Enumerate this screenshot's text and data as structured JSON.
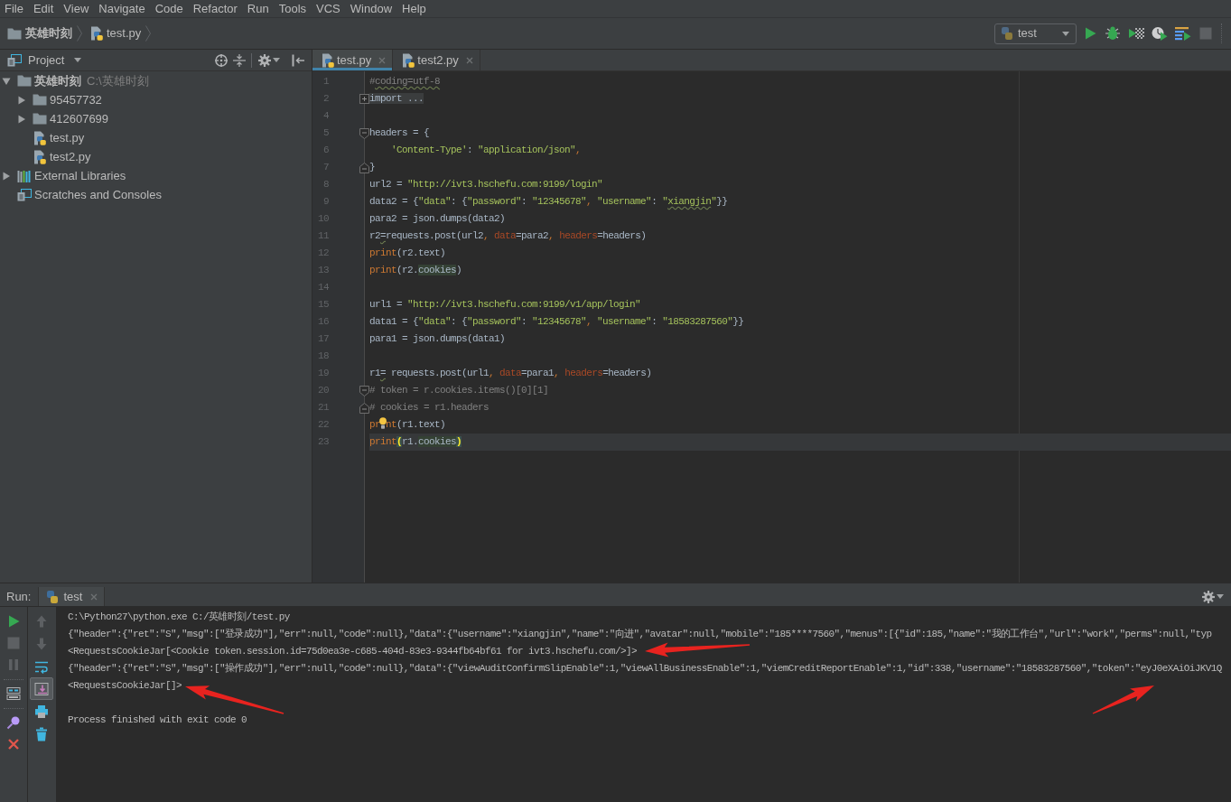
{
  "menu": [
    "File",
    "Edit",
    "View",
    "Navigate",
    "Code",
    "Refactor",
    "Run",
    "Tools",
    "VCS",
    "Window",
    "Help"
  ],
  "navigation_bar": {
    "breadcrumb": [
      {
        "label": "英雄时刻",
        "kind": "project-root"
      },
      {
        "label": "test.py",
        "kind": "python"
      }
    ],
    "run_config": "test",
    "toolbar": [
      {
        "kind": "run",
        "disabled": false
      },
      {
        "kind": "debug",
        "disabled": false
      },
      {
        "kind": "coverage",
        "disabled": false
      },
      {
        "kind": "profile",
        "disabled": false
      },
      {
        "kind": "concurrency",
        "disabled": false
      },
      {
        "kind": "stop",
        "disabled": true
      }
    ]
  },
  "project": {
    "title": "Project",
    "tools": [
      {
        "kind": "locate"
      },
      {
        "kind": "collapse"
      },
      {
        "kind": "separator"
      },
      {
        "kind": "settings"
      },
      {
        "kind": "hide"
      }
    ],
    "tree": [
      {
        "label": "英雄时刻",
        "path": "C:\\英雄时刻",
        "kind": "project-root",
        "expanded": true,
        "children": [
          {
            "label": "95457732",
            "kind": "folder",
            "expanded": false
          },
          {
            "label": "412607699",
            "kind": "folder",
            "expanded": false
          },
          {
            "label": "test.py",
            "kind": "python"
          },
          {
            "label": "test2.py",
            "kind": "python"
          }
        ]
      },
      {
        "label": "External Libraries",
        "kind": "library",
        "expanded": false
      },
      {
        "label": "Scratches and Consoles",
        "kind": "scratch"
      }
    ]
  },
  "editor": {
    "tabs": [
      {
        "label": "test.py",
        "selected": true
      },
      {
        "label": "test2.py",
        "selected": false
      }
    ],
    "lines": [
      {
        "number": "1",
        "current": false,
        "tokens": [
          {
            "text": "#",
            "kind": "comment"
          },
          {
            "text": "coding=utf-8",
            "kind": "comment",
            "decoration": {
              "kind": "wavy"
            }
          }
        ]
      },
      {
        "number": "2",
        "current": false,
        "fold": {
          "kind": "expand"
        },
        "tokens": [
          {
            "text": "import ...",
            "kind": "folded"
          }
        ]
      },
      {
        "number": "4",
        "current": false
      },
      {
        "number": "5",
        "current": false,
        "fold": {
          "kind": "start"
        },
        "tokens": [
          {
            "text": "headers = {",
            "kind": "plain"
          }
        ]
      },
      {
        "number": "6",
        "current": false,
        "tokens": [
          {
            "text": "    'Content-Type'",
            "kind": "string"
          },
          {
            "text": ": ",
            "kind": "plain"
          },
          {
            "text": "\"application/json\"",
            "kind": "string"
          },
          {
            "text": ",",
            "kind": "punct"
          }
        ]
      },
      {
        "number": "7",
        "current": false,
        "fold": {
          "kind": "end"
        },
        "tokens": [
          {
            "text": "}",
            "kind": "plain"
          }
        ]
      },
      {
        "number": "8",
        "current": false,
        "tokens": [
          {
            "text": "url2 = ",
            "kind": "plain"
          },
          {
            "text": "\"http://ivt3.hschefu.com:9199/login\"",
            "kind": "string"
          }
        ]
      },
      {
        "number": "9",
        "current": false,
        "tokens": [
          {
            "text": "data2 = {",
            "kind": "plain"
          },
          {
            "text": "\"data\"",
            "kind": "string"
          },
          {
            "text": ": {",
            "kind": "plain"
          },
          {
            "text": "\"password\"",
            "kind": "string"
          },
          {
            "text": ": ",
            "kind": "plain"
          },
          {
            "text": "\"12345678\"",
            "kind": "string"
          },
          {
            "text": ", ",
            "kind": "punct"
          },
          {
            "text": "\"username\"",
            "kind": "string"
          },
          {
            "text": ": ",
            "kind": "plain"
          },
          {
            "text": "\"",
            "kind": "string"
          },
          {
            "text": "xiangjin",
            "kind": "string",
            "decoration": {
              "kind": "wavy"
            }
          },
          {
            "text": "\"",
            "kind": "string"
          },
          {
            "text": "}}",
            "kind": "plain"
          }
        ]
      },
      {
        "number": "10",
        "current": false,
        "tokens": [
          {
            "text": "para2 = json.dumps(data2)",
            "kind": "plain"
          }
        ]
      },
      {
        "number": "11",
        "current": false,
        "tokens": [
          {
            "text": "r2",
            "kind": "plain"
          },
          {
            "text": "=",
            "kind": "plain",
            "decoration": {
              "kind": "wavy"
            }
          },
          {
            "text": "requests.post(url2",
            "kind": "plain"
          },
          {
            "text": ", ",
            "kind": "punct"
          },
          {
            "text": "data",
            "kind": "param"
          },
          {
            "text": "=para2",
            "kind": "plain"
          },
          {
            "text": ", ",
            "kind": "punct"
          },
          {
            "text": "headers",
            "kind": "param"
          },
          {
            "text": "=headers)",
            "kind": "plain"
          }
        ]
      },
      {
        "number": "12",
        "current": false,
        "tokens": [
          {
            "text": "print",
            "kind": "keyword"
          },
          {
            "text": "(r2.text)",
            "kind": "plain"
          }
        ]
      },
      {
        "number": "13",
        "current": false,
        "tokens": [
          {
            "text": "print",
            "kind": "keyword"
          },
          {
            "text": "(r2.",
            "kind": "plain"
          },
          {
            "text": "cookies",
            "kind": "plain",
            "decoration": {
              "kind": "usage"
            }
          },
          {
            "text": ")",
            "kind": "plain"
          }
        ]
      },
      {
        "number": "14",
        "current": false
      },
      {
        "number": "15",
        "current": false,
        "tokens": [
          {
            "text": "url1 = ",
            "kind": "plain"
          },
          {
            "text": "\"http://ivt3.hschefu.com:9199/v1/app/login\"",
            "kind": "string"
          }
        ]
      },
      {
        "number": "16",
        "current": false,
        "tokens": [
          {
            "text": "data1 = {",
            "kind": "plain"
          },
          {
            "text": "\"data\"",
            "kind": "string"
          },
          {
            "text": ": {",
            "kind": "plain"
          },
          {
            "text": "\"password\"",
            "kind": "string"
          },
          {
            "text": ": ",
            "kind": "plain"
          },
          {
            "text": "\"12345678\"",
            "kind": "string"
          },
          {
            "text": ", ",
            "kind": "punct"
          },
          {
            "text": "\"username\"",
            "kind": "string"
          },
          {
            "text": ": ",
            "kind": "plain"
          },
          {
            "text": "\"18583287560\"",
            "kind": "string"
          },
          {
            "text": "}}",
            "kind": "plain"
          }
        ]
      },
      {
        "number": "17",
        "current": false,
        "tokens": [
          {
            "text": "para1 = json.dumps(data1)",
            "kind": "plain"
          }
        ]
      },
      {
        "number": "18",
        "current": false
      },
      {
        "number": "19",
        "current": false,
        "tokens": [
          {
            "text": "r1",
            "kind": "plain"
          },
          {
            "text": "=",
            "kind": "plain",
            "decoration": {
              "kind": "wavy"
            }
          },
          {
            "text": " requests.post(url1",
            "kind": "plain"
          },
          {
            "text": ", ",
            "kind": "punct"
          },
          {
            "text": "data",
            "kind": "param"
          },
          {
            "text": "=para1",
            "kind": "plain"
          },
          {
            "text": ", ",
            "kind": "punct"
          },
          {
            "text": "headers",
            "kind": "param"
          },
          {
            "text": "=headers)",
            "kind": "plain"
          }
        ]
      },
      {
        "number": "20",
        "current": false,
        "fold": {
          "kind": "start"
        },
        "tokens": [
          {
            "text": "# token = r.cookies.items()[0][1]",
            "kind": "comment"
          }
        ]
      },
      {
        "number": "21",
        "current": false,
        "fold": {
          "kind": "end"
        },
        "tokens": [
          {
            "text": "# cookies = r1.headers",
            "kind": "comment"
          }
        ]
      },
      {
        "number": "22",
        "current": false,
        "tokens": [
          {
            "text": "pr",
            "kind": "keyword"
          },
          {
            "kind": "bulb"
          },
          {
            "text": "nt",
            "kind": "keyword"
          },
          {
            "text": "(r1.text)",
            "kind": "plain"
          }
        ]
      },
      {
        "number": "23",
        "current": true,
        "tokens": [
          {
            "text": "print",
            "kind": "keyword"
          },
          {
            "text": "(",
            "kind": "plain",
            "decoration": {
              "kind": "brace"
            }
          },
          {
            "text": "r1.",
            "kind": "plain"
          },
          {
            "text": "cookies",
            "kind": "plain",
            "decoration": {
              "kind": "usage"
            }
          },
          {
            "text": ")",
            "kind": "plain",
            "decoration": {
              "kind": "brace"
            }
          }
        ]
      }
    ]
  },
  "run": {
    "title": "Run:",
    "tab": "test",
    "toolbar": [
      {
        "kind": "rerun",
        "disabled": false
      },
      {
        "kind": "stop",
        "disabled": true
      },
      {
        "kind": "pause",
        "disabled": true
      },
      {
        "kind": "separator"
      },
      {
        "kind": "layout",
        "disabled": false
      },
      {
        "kind": "separator"
      },
      {
        "kind": "pin",
        "disabled": false
      },
      {
        "kind": "close",
        "disabled": false
      }
    ],
    "side_toolbar": [
      {
        "kind": "up",
        "disabled": true,
        "pressed": false
      },
      {
        "kind": "down",
        "disabled": true,
        "pressed": false
      },
      {
        "kind": "soft-wrap",
        "disabled": false,
        "pressed": false
      },
      {
        "kind": "scroll-end",
        "disabled": false,
        "pressed": true
      },
      {
        "kind": "print",
        "disabled": false,
        "pressed": false
      },
      {
        "kind": "trash",
        "disabled": false,
        "pressed": false
      }
    ],
    "console": [
      {
        "kind": "command",
        "text": "C:\\Python27\\python.exe C:/英雄时刻/test.py"
      },
      {
        "kind": "output",
        "text": "{\"header\":{\"ret\":\"S\",\"msg\":[\"登录成功\"],\"err\":null,\"code\":null},\"data\":{\"username\":\"xiangjin\",\"name\":\"向进\",\"avatar\":null,\"mobile\":\"185****7560\",\"menus\":[{\"id\":185,\"name\":\"我的工作台\",\"url\":\"work\",\"perms\":null,\"typ"
      },
      {
        "kind": "output",
        "text": "<RequestsCookieJar[<Cookie token.session.id=75d0ea3e-c685-404d-83e3-9344fb64bf61 for ivt3.hschefu.com/>]>"
      },
      {
        "kind": "output",
        "text": "{\"header\":{\"ret\":\"S\",\"msg\":[\"操作成功\"],\"err\":null,\"code\":null},\"data\":{\"viewAuditConfirmSlipEnable\":1,\"viewAllBusinessEnable\":1,\"viemCreditReportEnable\":1,\"id\":338,\"username\":\"18583287560\",\"token\":\"eyJ0eXAiOiJKV1Q"
      },
      {
        "kind": "output",
        "text": "<RequestsCookieJar[]>"
      },
      {
        "kind": "exit",
        "text": "Process finished with exit code 0"
      }
    ]
  },
  "annotations": [
    {
      "kind": "arrow"
    },
    {
      "kind": "arrow"
    },
    {
      "kind": "arrow"
    }
  ]
}
